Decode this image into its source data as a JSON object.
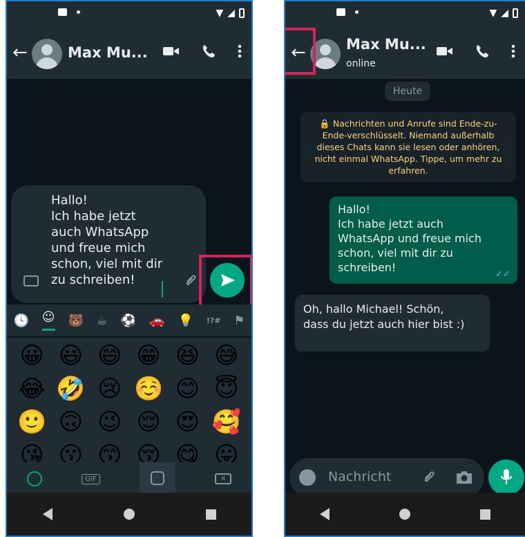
{
  "left": {
    "contact_name": "Max Mu...",
    "draft_text": "Hallo!\nIch habe jetzt auch WhatsApp und freue mich schon, viel mit dir zu schreiben!",
    "emoji_tabs": [
      "🕓",
      "☺",
      "🐻",
      "☕",
      "⚽",
      "🚗",
      "💡",
      "!?#",
      "⚑"
    ],
    "emojis": [
      "😀",
      "😃",
      "😄",
      "😁",
      "😆",
      "😅",
      "😂",
      "🤣",
      "😢",
      "☺️",
      "😊",
      "😇",
      "🙂",
      "🙃",
      "😉",
      "😌",
      "😍",
      "🥰",
      "😘",
      "😗",
      "😙",
      "😚",
      "😋",
      "😛"
    ],
    "footer": {
      "gif": "GIF"
    }
  },
  "right": {
    "contact_name": "Max Mu...",
    "status": "online",
    "date_chip": "Heute",
    "encryption_notice": "🔒 Nachrichten und Anrufe sind Ende-zu-Ende-verschlüsselt. Niemand außerhalb dieses Chats kann sie lesen oder anhören, nicht einmal WhatsApp. Tippe, um mehr zu erfahren.",
    "msg_out": "Hallo!\nIch habe jetzt auch WhatsApp und freue mich schon, viel mit dir zu schreiben!",
    "msg_in": "Oh, hallo Michael! Schön, dass du jetzt auch hier bist :)",
    "input_placeholder": "Nachricht"
  },
  "colors": {
    "accent": "#00a884",
    "highlight": "#d6245b",
    "header": "#1f2c34",
    "out_bubble": "#005c4b"
  }
}
